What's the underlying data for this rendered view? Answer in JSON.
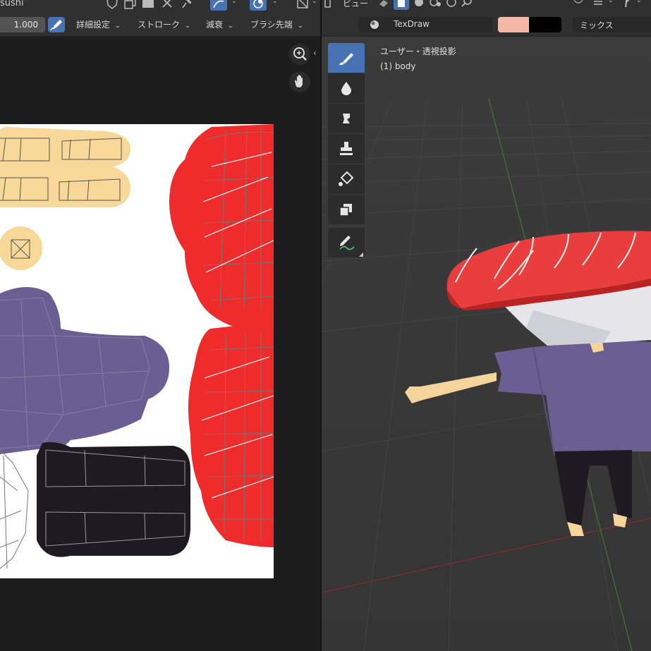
{
  "image_editor": {
    "title": "sushi",
    "strength_value": "1.000",
    "menus": [
      {
        "label": "詳細設定"
      },
      {
        "label": "ストローク"
      },
      {
        "label": "減衰"
      },
      {
        "label": "ブラシ先端"
      }
    ],
    "icons": [
      "zoom-icon",
      "hand-icon",
      "pen-icon"
    ]
  },
  "viewport": {
    "view_menu": "ビュー",
    "brush_name": "TexDraw",
    "primary_color": "#f4b9a6",
    "secondary_color": "#000000",
    "blend_mode": "ミックス",
    "view_label": "ユーザー・透視投影",
    "object_label": "(1) body",
    "tools": [
      "draw-brush",
      "soften-brush",
      "smear-brush",
      "clone-brush",
      "fill-brush",
      "mask-brush",
      "annotate"
    ]
  },
  "colors": {
    "accent": "#4772b3",
    "tuna_red": "#f02b2b",
    "skin": "#f4d49a",
    "shirt": "#6a5e92",
    "pants": "#1f1a22"
  }
}
